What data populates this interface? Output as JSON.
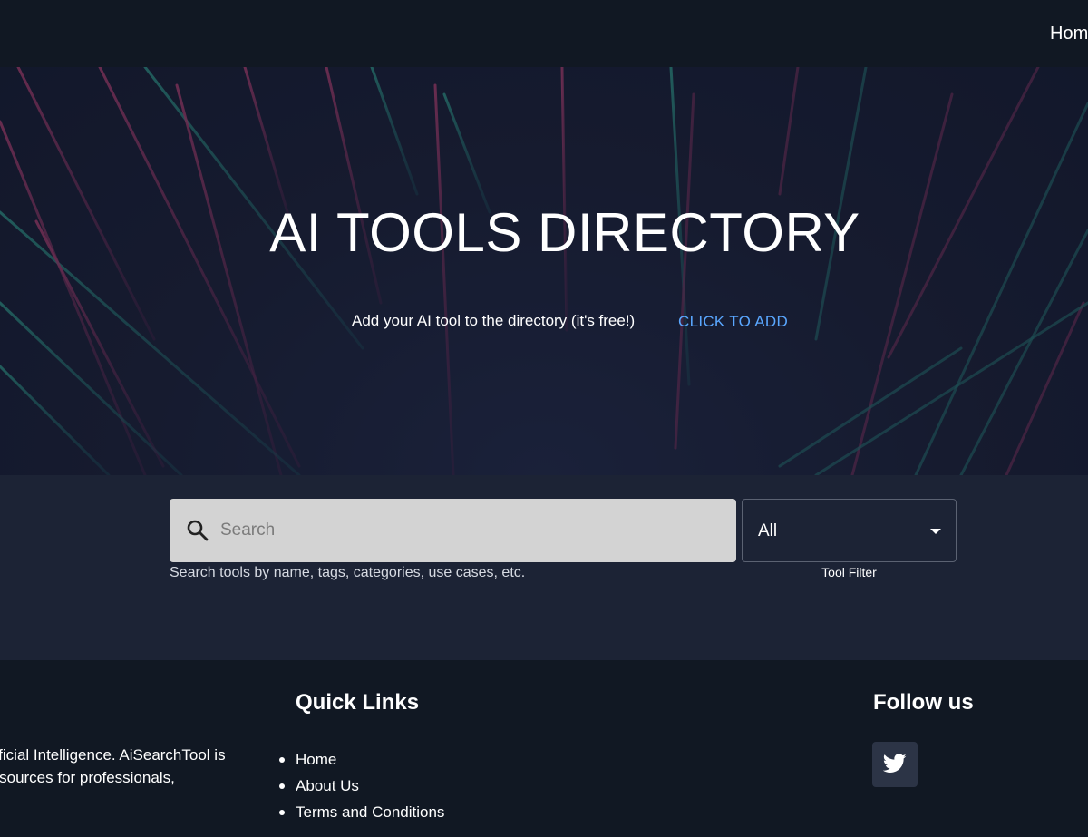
{
  "nav": {
    "home_label": "Hom"
  },
  "hero": {
    "title": "AI TOOLS DIRECTORY",
    "subtitle": "Add your AI tool to the directory (it's free!)",
    "cta_label": "CLICK TO ADD",
    "cta_color": "#5aa7ff"
  },
  "search": {
    "placeholder": "Search",
    "help_text": "Search tools by name, tags, categories, use cases, etc.",
    "icon": "search-icon"
  },
  "filter": {
    "selected": "All",
    "label": "Tool Filter",
    "icon": "caret-down-icon"
  },
  "footer": {
    "about_lines": [
      "rtificial Intelligence. AiSearchTool is",
      " resources for professionals,"
    ],
    "quick_links_title": "Quick Links",
    "quick_links": [
      "Home",
      "About Us",
      "Terms and Conditions"
    ],
    "follow_title": "Follow us",
    "social_icon": "twitter-icon"
  },
  "colors": {
    "header_bg": "#111823",
    "search_band_bg": "#1c2335",
    "footer_bg": "#111823",
    "link_blue": "#5aa7ff"
  }
}
